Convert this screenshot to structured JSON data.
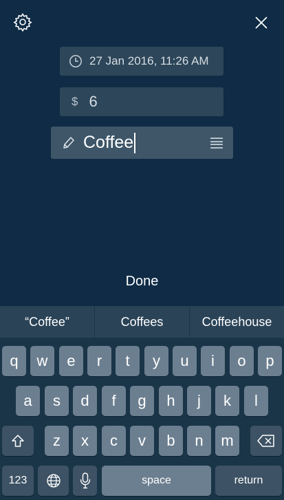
{
  "header": {
    "settings_icon": "gear-icon",
    "close_icon": "close-icon"
  },
  "form": {
    "date_icon": "clock-icon",
    "date_value": "27 Jan 2016, 11:26 AM",
    "currency_symbol": "$",
    "amount_value": "6",
    "note_icon": "pencil-icon",
    "note_value": "Coffee",
    "list_icon": "list-icon"
  },
  "done_label": "Done",
  "keyboard": {
    "suggestions": [
      "“Coffee”",
      "Coffees",
      "Coffeehouse"
    ],
    "row1": [
      "q",
      "w",
      "e",
      "r",
      "t",
      "y",
      "u",
      "i",
      "o",
      "p"
    ],
    "row2": [
      "a",
      "s",
      "d",
      "f",
      "g",
      "h",
      "j",
      "k",
      "l"
    ],
    "row3": [
      "z",
      "x",
      "c",
      "v",
      "b",
      "n",
      "m"
    ],
    "numbers_label": "123",
    "space_label": "space",
    "return_label": "return"
  },
  "colors": {
    "background": "#0f2b45",
    "field": "#2d4659",
    "key": "#6c7f90",
    "key_dark": "#3d5264"
  }
}
